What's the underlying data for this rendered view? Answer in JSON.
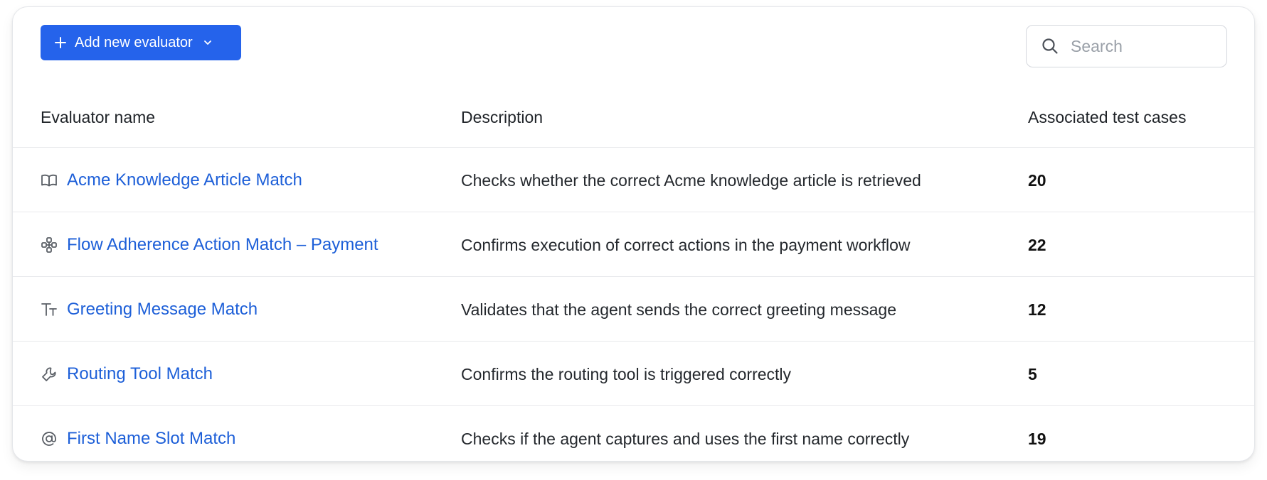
{
  "toolbar": {
    "add_button_label": "Add new evaluator",
    "search_placeholder": "Search",
    "search_value": ""
  },
  "table": {
    "headers": {
      "name": "Evaluator name",
      "description": "Description",
      "count": "Associated test cases"
    },
    "rows": [
      {
        "icon": "book-icon",
        "name": "Acme Knowledge Article Match",
        "description": "Checks whether the correct Acme knowledge article is retrieved",
        "count": "20"
      },
      {
        "icon": "flow-icon",
        "name": "Flow Adherence Action Match – Payment",
        "description": "Confirms execution of correct actions in the payment workflow",
        "count": "22"
      },
      {
        "icon": "text-size-icon",
        "name": "Greeting Message Match",
        "description": "Validates that the agent sends the correct greeting message",
        "count": "12"
      },
      {
        "icon": "wrench-icon",
        "name": "Routing Tool Match",
        "description": "Confirms the routing tool is triggered correctly",
        "count": "5"
      },
      {
        "icon": "at-sign-icon",
        "name": "First Name Slot Match",
        "description": "Checks if the agent captures and uses the first name correctly",
        "count": "19"
      }
    ]
  },
  "colors": {
    "accent": "#2563eb",
    "link": "#1d5fd8",
    "border": "#e8e9ec"
  }
}
